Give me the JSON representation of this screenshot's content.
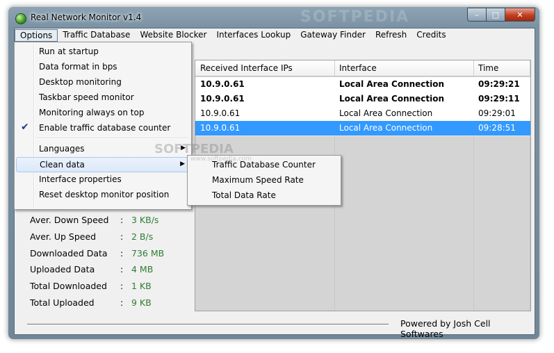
{
  "window": {
    "title": "Real Network Monitor v1.4",
    "watermark": "SOFTPEDIA"
  },
  "caption_buttons": {
    "minimize": "–",
    "maximize": "□",
    "close": "✕"
  },
  "menubar": [
    "Options",
    "Traffic Database",
    "Website Blocker",
    "Interfaces Lookup",
    "Gateway Finder",
    "Refresh",
    "Credits"
  ],
  "options_menu": {
    "items": [
      "Run at startup",
      "Data format in bps",
      "Desktop monitoring",
      "Taskbar speed monitor",
      "Monitoring always on top",
      "Enable traffic database counter",
      "Languages",
      "Clean data",
      "Interface properties",
      "Reset desktop monitor position"
    ],
    "check_glyph": "✔",
    "arrow_glyph": "▶"
  },
  "clean_data_submenu": [
    "Traffic Database Counter",
    "Maximum Speed Rate",
    "Total Data Rate"
  ],
  "table": {
    "headers": [
      "Received Interface IPs",
      "Interface",
      "Time"
    ],
    "rows": [
      [
        "10.9.0.61",
        "Local Area Connection",
        "09:29:21"
      ],
      [
        "10.9.0.61",
        "Local Area Connection",
        "09:29:11"
      ],
      [
        "10.9.0.61",
        "Local Area Connection",
        "09:29:01"
      ],
      [
        "10.9.0.61",
        "Local Area Connection",
        "09:28:51"
      ]
    ]
  },
  "stats": [
    {
      "label": "Aver. Down Speed",
      "value": "3 KB/s"
    },
    {
      "label": "Aver. Up Speed",
      "value": "2 B/s"
    },
    {
      "label": "Downloaded Data",
      "value": "736 MB"
    },
    {
      "label": "Uploaded Data",
      "value": "4 MB"
    },
    {
      "label": "Total Downloaded",
      "value": "1 KB"
    },
    {
      "label": "Total Uploaded",
      "value": "9 KB"
    }
  ],
  "stats_colon": ":",
  "footer": "Powered by Josh Cell Softwares",
  "watermark_center": "SOFTPEDIA",
  "watermark_url": "www.softpedia.com",
  "colors": {
    "selection": "#3399ff",
    "stat_value": "#2e7d32"
  }
}
